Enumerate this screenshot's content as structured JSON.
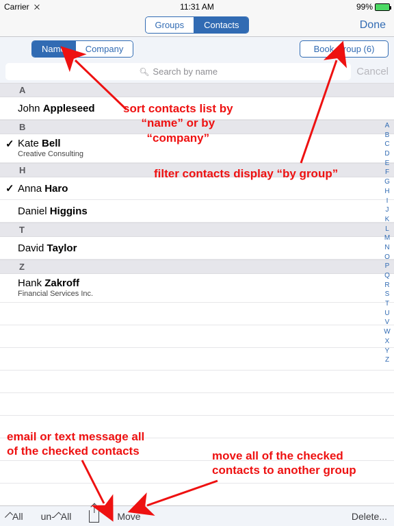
{
  "status": {
    "carrier": "Carrier",
    "wifi": "▲",
    "time": "11:31 AM",
    "battery_pct": "99%"
  },
  "nav": {
    "segment": {
      "left": "Groups",
      "right": "Contacts",
      "active": "right"
    },
    "done": "Done"
  },
  "filter": {
    "sort_segment": {
      "left": "Name",
      "right": "Company",
      "active": "left"
    },
    "group_button": "Book Group (6)"
  },
  "search": {
    "placeholder": "Search by name",
    "cancel": "Cancel"
  },
  "index_letters": [
    "A",
    "B",
    "C",
    "D",
    "E",
    "F",
    "G",
    "H",
    "I",
    "J",
    "K",
    "L",
    "M",
    "N",
    "O",
    "P",
    "Q",
    "R",
    "S",
    "T",
    "U",
    "V",
    "W",
    "X",
    "Y",
    "Z"
  ],
  "sections": [
    {
      "letter": "A",
      "rows": [
        {
          "checked": false,
          "first": "John",
          "last": "Appleseed",
          "company": ""
        }
      ]
    },
    {
      "letter": "B",
      "rows": [
        {
          "checked": true,
          "first": "Kate",
          "last": "Bell",
          "company": "Creative Consulting"
        }
      ]
    },
    {
      "letter": "H",
      "rows": [
        {
          "checked": true,
          "first": "Anna",
          "last": "Haro",
          "company": ""
        },
        {
          "checked": false,
          "first": "Daniel",
          "last": "Higgins",
          "company": ""
        }
      ]
    },
    {
      "letter": "T",
      "rows": [
        {
          "checked": false,
          "first": "David",
          "last": "Taylor",
          "company": ""
        }
      ]
    },
    {
      "letter": "Z",
      "rows": [
        {
          "checked": false,
          "first": "Hank",
          "last": "Zakroff",
          "company": "Financial Services Inc."
        }
      ]
    }
  ],
  "toolbar": {
    "all": "All",
    "un_all": "un-",
    "un_all2": "All",
    "move": "Move",
    "delete": "Delete..."
  },
  "annotations": {
    "sort": "sort contacts list by\n“name” or by\n“company”",
    "filter": "filter contacts display “by group”",
    "share": "email or text message all\nof the checked contacts",
    "move": "move all of the checked\ncontacts to another group"
  }
}
